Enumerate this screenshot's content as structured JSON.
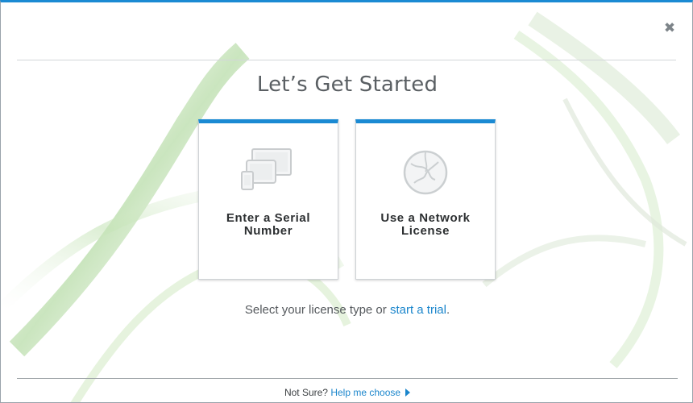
{
  "dialog": {
    "title": "Let’s Get Started",
    "close_icon": "close-icon",
    "accent_color": "#1b8ad3"
  },
  "cards": [
    {
      "label_line1": "Enter a Serial",
      "label_line2": "Number",
      "icon": "devices-icon"
    },
    {
      "label_line1": "Use a Network",
      "label_line2": "License",
      "icon": "globe-icon"
    }
  ],
  "prompt": {
    "text": "Select your license type or",
    "link": "start a trial",
    "end": "."
  },
  "footer": {
    "question": "Not Sure?",
    "link": "Help me choose",
    "link_icon": "caret-right-icon"
  }
}
